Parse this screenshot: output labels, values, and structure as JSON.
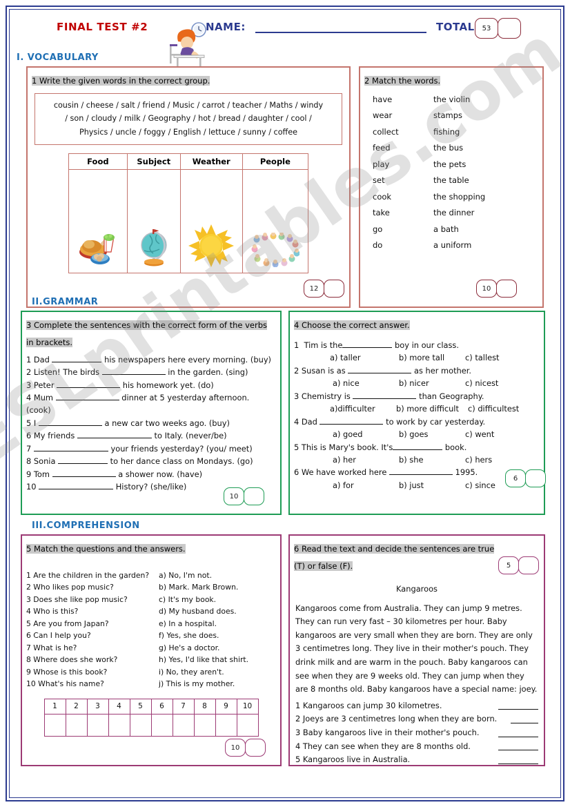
{
  "header": {
    "title": "FINAL TEST #2",
    "name_label": "NAME:",
    "total_label": "TOTAL:",
    "total_value": "53",
    "total_blank": "",
    "clipart": "student-writing-at-desk-with-clock"
  },
  "sections": {
    "vocabulary": "I.   VOCABULARY",
    "grammar": "II.GRAMMAR",
    "comprehension": "III.COMPREHENSION"
  },
  "watermark": "ESLprintables.com",
  "ex1": {
    "instruction": "1 Write the given words in the correct group.",
    "wordbank_lines": [
      "cousin / cheese / salt / friend / Music / carrot / teacher / Maths / windy",
      "/ son / cloudy / milk / Geography / hot / bread / daughter / cool /",
      "Physics / uncle / foggy / English / lettuce / sunny / coffee"
    ],
    "columns": [
      "Food",
      "Subject",
      "Weather",
      "People"
    ],
    "column_icons": [
      "roast-dinner-icon",
      "globe-icon",
      "sun-icon",
      "group-of-people-icon"
    ],
    "score": "12",
    "score_blank": ""
  },
  "ex2": {
    "instruction": "2 Match the words.",
    "pairs": [
      {
        "verb": "have",
        "object": "the violin"
      },
      {
        "verb": "wear",
        "object": "stamps"
      },
      {
        "verb": "collect",
        "object": "fishing"
      },
      {
        "verb": "feed",
        "object": "the bus"
      },
      {
        "verb": "play",
        "object": "the pets"
      },
      {
        "verb": "set",
        "object": "the table"
      },
      {
        "verb": "cook",
        "object": "the shopping"
      },
      {
        "verb": "take",
        "object": "the dinner"
      },
      {
        "verb": "go",
        "object": "a bath"
      },
      {
        "verb": "do",
        "object": "a uniform"
      }
    ],
    "score": "10",
    "score_blank": ""
  },
  "ex3": {
    "instruction": "3 Complete the  sentences with the correct form of the verbs in brackets.",
    "items": [
      {
        "num": "1",
        "before": "Dad ",
        "after": " his newspapers here every morning. (buy)",
        "blank": "m"
      },
      {
        "num": "2",
        "before": "Listen! The birds ",
        "after": " in the garden. (sing)",
        "blank": "l"
      },
      {
        "num": "3",
        "before": "Peter ",
        "after": " his homework yet. (do)",
        "blank": "l"
      },
      {
        "num": "4",
        "before": "Mum ",
        "after": " dinner at 5 yesterday afternoon. (cook)",
        "blank": "l"
      },
      {
        "num": "5",
        "before": "I ",
        "after": " a new car two weeks ago. (buy)",
        "blank": "l"
      },
      {
        "num": "6",
        "before": "My friends ",
        "after": " to Italy. (never/be)",
        "blank": "x"
      },
      {
        "num": "7",
        "before": " ",
        "after": " your friends yesterday? (you/ meet)",
        "blank": "x"
      },
      {
        "num": "8",
        "before": "Sonia ",
        "after": " to her dance class on Mondays. (go)",
        "blank": "m"
      },
      {
        "num": "9",
        "before": "Tom ",
        "after": " a shower now. (have)",
        "blank": "l"
      },
      {
        "num": "10",
        "before": " ",
        "after": " History? (she/like)",
        "blank": "x"
      }
    ],
    "score": "10",
    "score_blank": ""
  },
  "ex4": {
    "instruction": "4 Choose the correct answer.",
    "items": [
      {
        "num": "1",
        "before": "Tim is the",
        "after": " boy in our class.",
        "blank": "m",
        "options": [
          "a) taller",
          "b) more tall",
          "c) tallest"
        ]
      },
      {
        "num": "2",
        "before": "Susan is as ",
        "after": " as her mother.",
        "blank": "l",
        "options": [
          "a) nice",
          "b) nicer",
          "c) nicest"
        ]
      },
      {
        "num": "3",
        "before": "Chemistry is ",
        "after": " than Geography.",
        "blank": "l",
        "options": [
          "a)difficulter",
          "b) more difficult",
          "c) difficultest"
        ]
      },
      {
        "num": "4",
        "before": "Dad ",
        "after": " to work by car yesterday.",
        "blank": "l",
        "options": [
          "a) goed",
          "b) goes",
          "c) went"
        ]
      },
      {
        "num": "5",
        "before": "This is Mary's book. It's",
        "after": " book.",
        "blank": "m",
        "options": [
          "a) her",
          "b) she",
          "c) hers"
        ]
      },
      {
        "num": "6",
        "before": "We have worked here ",
        "after": " 1995.",
        "blank": "l",
        "options": [
          "a) for",
          "b) just",
          "c) since"
        ]
      }
    ],
    "score": "6",
    "score_blank": ""
  },
  "ex5": {
    "instruction": "5 Match the questions and the answers.",
    "questions": [
      "1 Are the children in the garden?",
      "2 Who likes pop music?",
      "3 Does she like pop music?",
      "4 Who is this?",
      "5 Are you from Japan?",
      "6 Can I help you?",
      "7 What is he?",
      "8 Where does she work?",
      "9 Whose is this book?",
      "10 What's his name?"
    ],
    "answers": [
      "a) No, I'm not.",
      "b) Mark. Mark Brown.",
      "c) It's my book.",
      "d) My husband does.",
      "e) In a hospital.",
      "f) Yes, she does.",
      "g) He's a doctor.",
      "h) Yes, I'd like that shirt.",
      "i) No, they aren't.",
      "j) This is my mother."
    ],
    "grid_headers": [
      "1",
      "2",
      "3",
      "4",
      "5",
      "6",
      "7",
      "8",
      "9",
      "10"
    ],
    "grid_values": [
      "",
      "",
      "",
      "",
      "",
      "",
      "",
      "",
      "",
      ""
    ],
    "score": "10",
    "score_blank": ""
  },
  "ex6": {
    "instruction": "6 Read the text and decide the sentences are true (T) or false (F).",
    "text_title": "Kangaroos",
    "text": "Kangaroos come from Australia. They can jump 9 metres. They can run very fast – 30 kilometres per hour. Baby kangaroos are very small when they are born. They are only 3 centimetres long. They live in their mother's pouch. They drink milk and are warm in the pouch. Baby kangaroos can see when they are 9 weeks old. They can jump when they are 8 months old. Baby kangaroos have a special name: joey.",
    "statements": [
      "1 Kangaroos can jump 30 kilometres.",
      "2 Joeys are 3 centimetres long when they are born.",
      "3 Baby kangaroos live in their mother's pouch.",
      "4 They can see when they are 8 months old.",
      "5 Kangaroos live in Australia."
    ],
    "score": "5",
    "score_blank": ""
  },
  "colors": {
    "frame_blue": "#2b3a8f",
    "title_red": "#c00000",
    "section_blue": "#1f6fb4",
    "panel_red": "#c4746c",
    "panel_green": "#1e9c55",
    "panel_purple": "#9c3a74",
    "highlight_grey": "#c9c9c9"
  }
}
